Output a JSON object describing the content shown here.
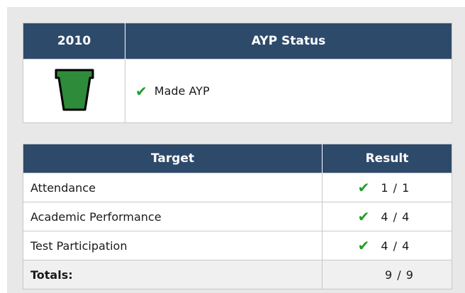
{
  "status_table": {
    "header_year": "2010",
    "header_status": "AYP Status",
    "status_icon": "keystone-icon",
    "check_icon": "check-icon",
    "status_text": "Made AYP"
  },
  "target_table": {
    "header_target": "Target",
    "header_result": "Result",
    "rows": [
      {
        "target": "Attendance",
        "result": "1 / 1",
        "met": true
      },
      {
        "target": "Academic Performance",
        "result": "4 / 4",
        "met": true
      },
      {
        "target": "Test Participation",
        "result": "4 / 4",
        "met": true
      }
    ],
    "totals_label": "Totals:",
    "totals_result": "9 / 9"
  },
  "colors": {
    "header_bg": "#2e4a6b",
    "check": "#1f9e2a",
    "keystone_fill": "#2e8b3a"
  }
}
